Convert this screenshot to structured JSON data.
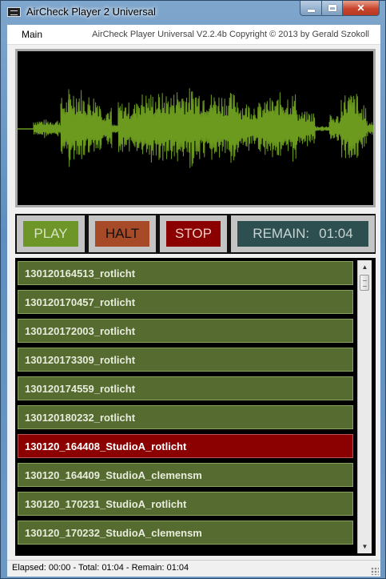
{
  "window": {
    "title": "AirCheck Player 2 Universal",
    "icon": "app-icon"
  },
  "menu": {
    "main_label": "Main",
    "copyright": "AirCheck Player Universal V2.2.4b Copyright © 2013 by Gerald Szokoll"
  },
  "controls": {
    "play_label": "PLAY",
    "halt_label": "HALT",
    "stop_label": "STOP",
    "remain_label": "REMAIN:",
    "remain_value": "01:04"
  },
  "playlist": [
    {
      "label": "130120164513_rotlicht",
      "selected": false
    },
    {
      "label": "130120170457_rotlicht",
      "selected": false
    },
    {
      "label": "130120172003_rotlicht",
      "selected": false
    },
    {
      "label": "130120173309_rotlicht",
      "selected": false
    },
    {
      "label": "130120174559_rotlicht",
      "selected": false
    },
    {
      "label": "130120180232_rotlicht",
      "selected": false
    },
    {
      "label": "130120_164408_StudioA_rotlicht",
      "selected": true
    },
    {
      "label": "130120_164409_StudioA_clemensm",
      "selected": false
    },
    {
      "label": "130120_170231_StudioA_rotlicht",
      "selected": false
    },
    {
      "label": "130120_170232_StudioA_clemensm",
      "selected": false
    }
  ],
  "status": {
    "text": "Elapsed: 00:00 - Total: 01:04 - Remain: 01:04"
  },
  "colors": {
    "waveform": "#6b9a1f",
    "play": "#6e9528",
    "halt": "#a64a27",
    "stop": "#8b0000",
    "remain": "#2e4f4f",
    "list_item": "#556b2f",
    "list_selected": "#8b0000"
  }
}
